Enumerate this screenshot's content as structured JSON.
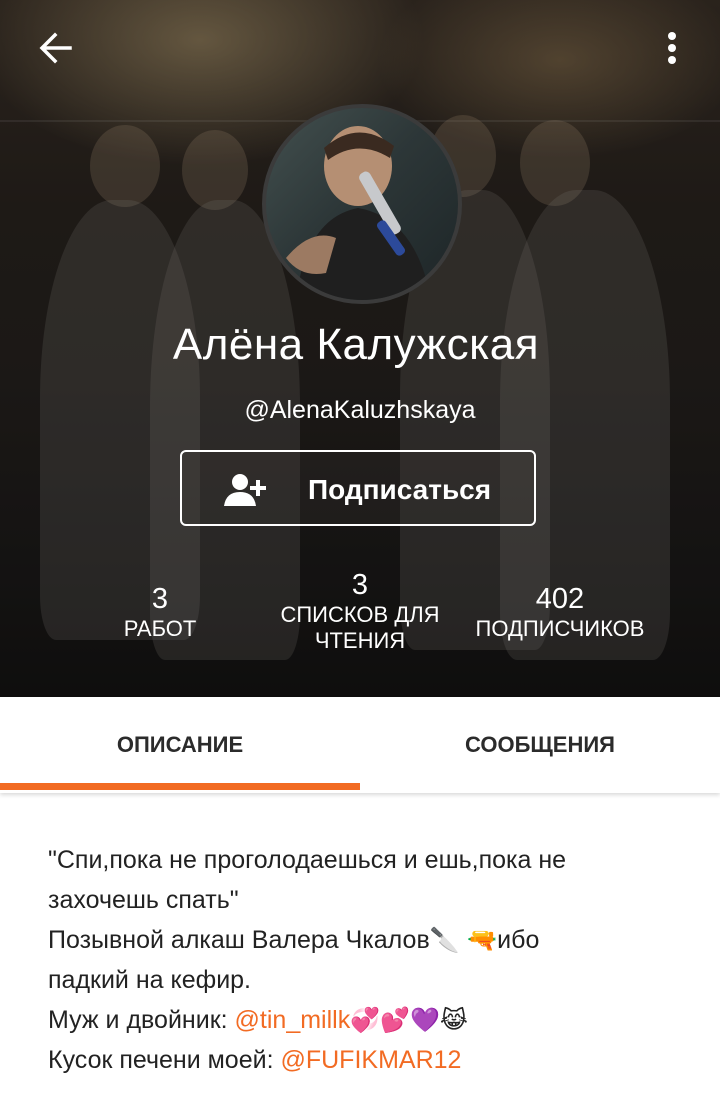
{
  "header": {
    "back_icon": "arrow-left-icon",
    "more_icon": "more-vertical-icon"
  },
  "profile": {
    "name": "Алёна Калужская",
    "handle": "@AlenaKaluzhskaya",
    "follow_button_label": "Подписаться",
    "follow_icon": "add-user-icon"
  },
  "stats": [
    {
      "value": "3",
      "label": "РАБОТ"
    },
    {
      "value": "3",
      "label_line1": "СПИСКОВ ДЛЯ",
      "label_line2": "ЧТЕНИЯ"
    },
    {
      "value": "402",
      "label": "ПОДПИСЧИКОВ"
    }
  ],
  "tabs": [
    {
      "label": "ОПИСАНИЕ",
      "active": true
    },
    {
      "label": "СООБЩЕНИЯ",
      "active": false
    }
  ],
  "description": {
    "line1": "\"Спи,пока не проголодаешься и ешь,пока не",
    "line2": "захочешь спать\"",
    "line3_text": "Позывной алкаш Валера Чкалов",
    "line3_emoji": "🔪 🔫",
    "line3_suffix": "ибо",
    "line4": "падкий на кефир.",
    "line5_text": "Муж и двойник: ",
    "line5_mention": "@tin_millk",
    "line5_emoji": "💞💕💜😹",
    "line6_text": "Кусок печени моей: ",
    "line6_mention": "@FUFIKMAR12"
  },
  "colors": {
    "accent": "#f26b23",
    "text": "#222222"
  }
}
